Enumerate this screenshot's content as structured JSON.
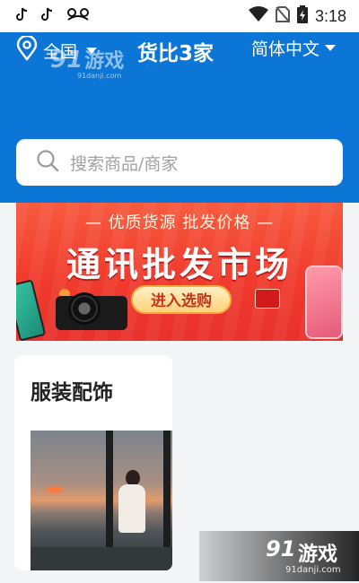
{
  "status_bar": {
    "time": "3:18",
    "left_icons": [
      "tiktok-icon",
      "tiktok-icon",
      "notification-icon"
    ],
    "right_icons": [
      "wifi-icon",
      "no-sim-icon",
      "battery-charging-icon"
    ]
  },
  "header": {
    "watermark": {
      "logo": "91",
      "text": "游戏",
      "url": "91danji.com"
    },
    "location": {
      "label": "全国",
      "icon": "location-pin-icon"
    },
    "app_title": "货比3家",
    "language": {
      "label": "简体中文"
    },
    "search": {
      "placeholder": "搜索商品/商家",
      "icon": "search-icon"
    }
  },
  "banner": {
    "subtitle": "— 优质货源 批发价格 —",
    "title": "通讯批发市场",
    "cta_label": "进入选购"
  },
  "category_card": {
    "title": "服装配饰"
  },
  "watermark_bottom": {
    "logo": "91",
    "text": "游戏",
    "url": "91danji.com"
  },
  "colors": {
    "header_blue": "#0b76d6",
    "banner_red": "#f03b2d",
    "page_bg": "#f3f4f6"
  }
}
